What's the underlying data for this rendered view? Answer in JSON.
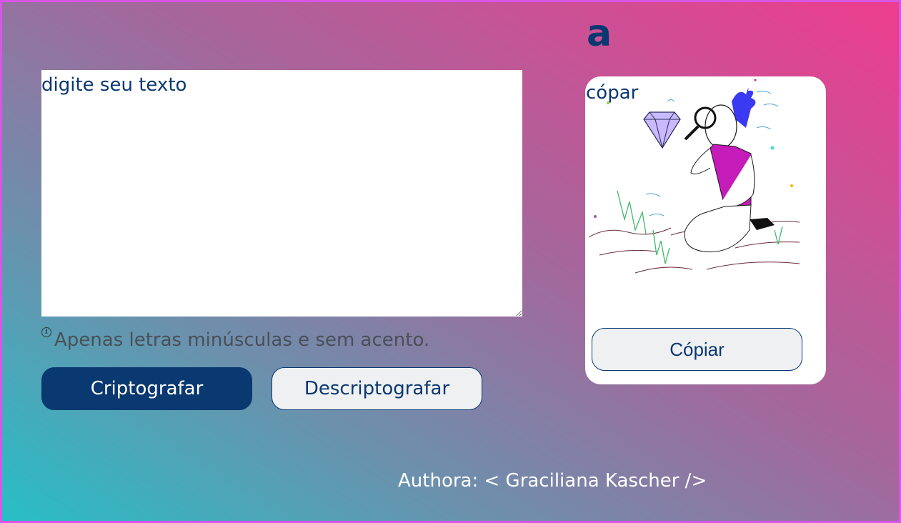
{
  "header": {
    "logo_text": "a"
  },
  "input": {
    "placeholder": "digite seu texto",
    "value": ""
  },
  "hint": {
    "icon": "info-icon",
    "text": "Apenas letras minúsculas e sem acento."
  },
  "actions": {
    "encrypt_label": "Criptografar",
    "decrypt_label": "Descriptografar"
  },
  "output": {
    "text": "cópar",
    "illustration": "person-with-magnifier-looking-at-diamond",
    "copy_label": "Cópiar"
  },
  "footer": {
    "text": "Authora: < Graciliana Kascher />"
  },
  "colors": {
    "primary": "#0a3871",
    "button_light": "#eff0f1",
    "background_top_right": "#ee3c8e",
    "background_bottom_left": "#27bfc6",
    "border": "#d856e6"
  }
}
